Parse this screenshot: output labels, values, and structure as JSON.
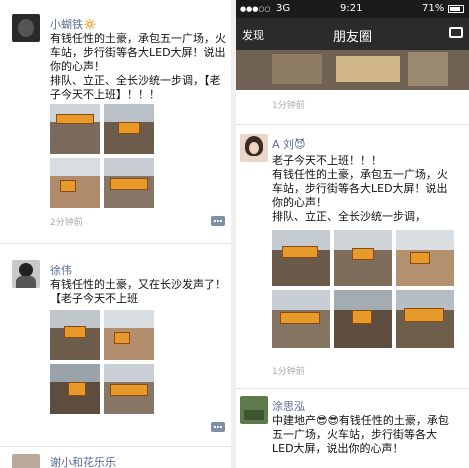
{
  "left": {
    "posts": [
      {
        "name": "小蝴铁🔅",
        "lines": [
          "有钱任性的土豪，承包五一广场，火",
          "车站，步行街等各大LED大屏！说出",
          "你的心声！",
          "排队、立正、全长沙统一步调，【老",
          "子今天不上班】！！！"
        ],
        "time": "2分钟前"
      },
      {
        "name": "徐伟",
        "lines": [
          "有钱任性的土豪，又在长沙发声了！",
          "【老子今天不上班"
        ],
        "time": "2分钟前"
      },
      {
        "name": "谢小和花乐乐"
      }
    ]
  },
  "right": {
    "status": {
      "signal": "●●●○○",
      "carrier": "3G",
      "time": "9:21",
      "battery": "71%"
    },
    "nav": {
      "back": "发现",
      "title": "朋友圈"
    },
    "first_time": "1分钟前",
    "posts": [
      {
        "name": "A 刘😈",
        "lines": [
          "老子今天不上班！！！",
          "有钱任性的土豪，承包五一广场，火",
          "车站，步行街等各大LED大屏！说出",
          "你的心声！",
          "排队、立正、全长沙统一步调，"
        ],
        "time": "1分钟前"
      },
      {
        "name": "涂思泓",
        "lines": [
          "中建地产😎😎有钱任性的土豪，承包",
          "五一广场，火车站，步行街等各大",
          "LED大屏，说出你的心声！"
        ]
      }
    ]
  },
  "colors": {
    "name_link": "#576b95",
    "nav_bg": "#2b2b2b"
  }
}
